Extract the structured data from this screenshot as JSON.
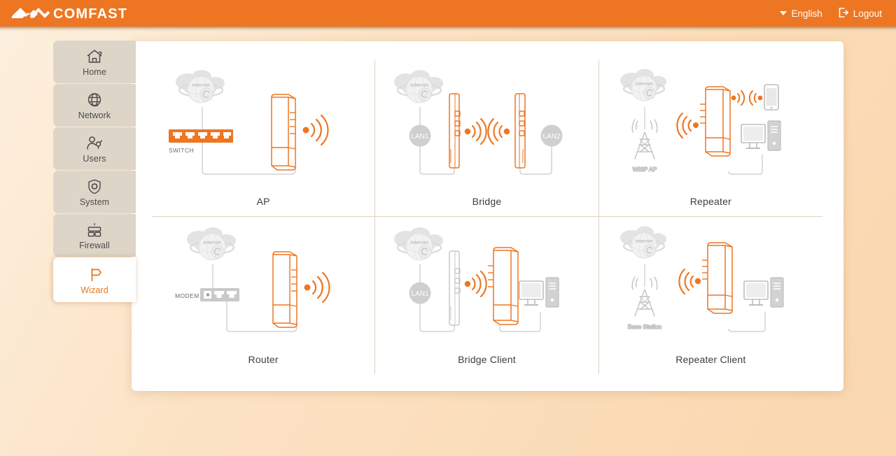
{
  "header": {
    "brand": "COMFAST",
    "language": {
      "label": "English",
      "caret_icon": "chevron-down-icon"
    },
    "logout": {
      "label": "Logout",
      "icon": "logout-icon"
    },
    "background_color": "#ee7622"
  },
  "sidebar": {
    "items": [
      {
        "label": "Home",
        "icon": "home-icon",
        "active": false
      },
      {
        "label": "Network",
        "icon": "globe-icon",
        "active": false
      },
      {
        "label": "Users",
        "icon": "users-icon",
        "active": false
      },
      {
        "label": "System",
        "icon": "shield-gear-icon",
        "active": false
      },
      {
        "label": "Firewall",
        "icon": "firewall-icon",
        "active": false
      },
      {
        "label": "Wizard",
        "icon": "signpost-icon",
        "active": true
      }
    ],
    "active_color": "#e2781f",
    "inactive_background": "#ded5c9"
  },
  "main": {
    "modes": [
      {
        "label": "AP",
        "nodes": [
          "Internet",
          "SWITCH"
        ],
        "devices": [
          "switch",
          "cpe",
          "wifi-signal"
        ]
      },
      {
        "label": "Bridge",
        "nodes": [
          "Internet",
          "LAN1",
          "LAN2"
        ],
        "devices": [
          "cpe-side",
          "wifi-signal",
          "wifi-signal",
          "cpe-side"
        ]
      },
      {
        "label": "Repeater",
        "nodes": [
          "Internet",
          "WISP AP"
        ],
        "devices": [
          "tower",
          "cpe",
          "smartphone",
          "desktop"
        ]
      },
      {
        "label": "Router",
        "nodes": [
          "Internet",
          "MODEM"
        ],
        "devices": [
          "modem",
          "cpe",
          "wifi-signal"
        ]
      },
      {
        "label": "Bridge Client",
        "nodes": [
          "Internet",
          "LAN1"
        ],
        "devices": [
          "cpe-side",
          "wifi-signal",
          "cpe",
          "desktop"
        ]
      },
      {
        "label": "Repeater Client",
        "nodes": [
          "Internet",
          "Base Station"
        ],
        "devices": [
          "tower",
          "cpe",
          "desktop"
        ]
      }
    ],
    "accent_color": "#ee7622",
    "divider_color": "#ded2c0"
  }
}
